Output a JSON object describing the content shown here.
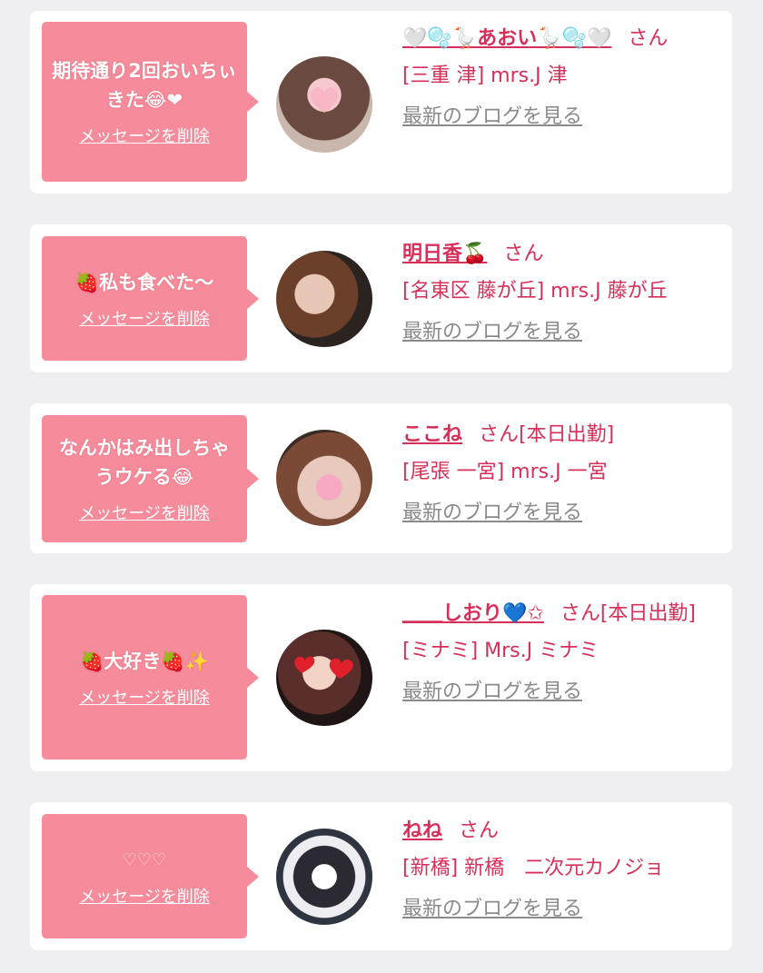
{
  "colors": {
    "accent": "#d6305a",
    "bubble": "#f68c9b",
    "background": "#efeff1",
    "link_gray": "#8a8a8a"
  },
  "cards": [
    {
      "message": "期待通り2回おいちぃきた😂❤",
      "delete_label": "メッセージを削除",
      "name": "🤍🫧🪿あおい🪿🫧🤍",
      "san": "さん",
      "status": "",
      "shop": "[三重 津] mrs.J 津",
      "blog_label": "最新のブログを見る"
    },
    {
      "message": "🍓私も食べた〜",
      "delete_label": "メッセージを削除",
      "name": "明日香🍒",
      "san": "さん",
      "status": "",
      "shop": "[名東区 藤が丘] mrs.J 藤が丘",
      "blog_label": "最新のブログを見る"
    },
    {
      "message": "なんかはみ出しちゃうウケる😂",
      "delete_label": "メッセージを削除",
      "name": "ここね",
      "san": "さん",
      "status": "[本日出勤]",
      "shop": "[尾張 一宮] mrs.J 一宮",
      "blog_label": "最新のブログを見る"
    },
    {
      "message": "🍓大好き🍓✨",
      "delete_label": "メッセージを削除",
      "name": "＿＿しおり💙✩",
      "san": "さん",
      "status": "[本日出勤]",
      "shop": "[ミナミ] Mrs.J ミナミ",
      "blog_label": "最新のブログを見る"
    },
    {
      "message": "♡♡♡",
      "delete_label": "メッセージを削除",
      "name": "ねね",
      "san": "さん",
      "status": "",
      "shop": "[新橋] 新橋　二次元カノジョ",
      "blog_label": "最新のブログを見る"
    }
  ]
}
